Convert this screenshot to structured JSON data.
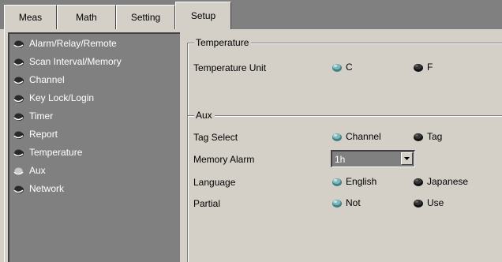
{
  "tabs": [
    {
      "label": "Meas",
      "active": false
    },
    {
      "label": "Math",
      "active": false
    },
    {
      "label": "Setting",
      "active": false
    },
    {
      "label": "Setup",
      "active": true
    }
  ],
  "nav": {
    "items": [
      {
        "label": "Alarm/Relay/Remote",
        "selected": false
      },
      {
        "label": "Scan Interval/Memory",
        "selected": false
      },
      {
        "label": "Channel",
        "selected": false
      },
      {
        "label": "Key Lock/Login",
        "selected": false
      },
      {
        "label": "Timer",
        "selected": false
      },
      {
        "label": "Report",
        "selected": false
      },
      {
        "label": "Temperature",
        "selected": false
      },
      {
        "label": "Aux",
        "selected": true
      },
      {
        "label": "Network",
        "selected": false
      }
    ]
  },
  "temperature": {
    "group_title": "Temperature",
    "unit_label": "Temperature Unit",
    "options": [
      {
        "label": "C",
        "selected": true
      },
      {
        "label": "F",
        "selected": false
      }
    ]
  },
  "aux": {
    "group_title": "Aux",
    "tag_select": {
      "label": "Tag Select",
      "options": [
        {
          "label": "Channel",
          "selected": true
        },
        {
          "label": "Tag",
          "selected": false
        }
      ]
    },
    "memory_alarm": {
      "label": "Memory Alarm",
      "value": "1h"
    },
    "language": {
      "label": "Language",
      "options": [
        {
          "label": "English",
          "selected": true
        },
        {
          "label": "Japanese",
          "selected": false
        }
      ]
    },
    "partial": {
      "label": "Partial",
      "options": [
        {
          "label": "Not",
          "selected": true
        },
        {
          "label": "Use",
          "selected": false
        }
      ]
    }
  },
  "colors": {
    "selected_knob": "#5aa0a8",
    "unselected_knob": "#2a2a2a",
    "panel_bg": "#d4d0c8",
    "nav_bg": "#808080"
  },
  "icons": {
    "radio_button": "radio-knob-icon",
    "dropdown_arrow": "chevron-down-icon"
  }
}
